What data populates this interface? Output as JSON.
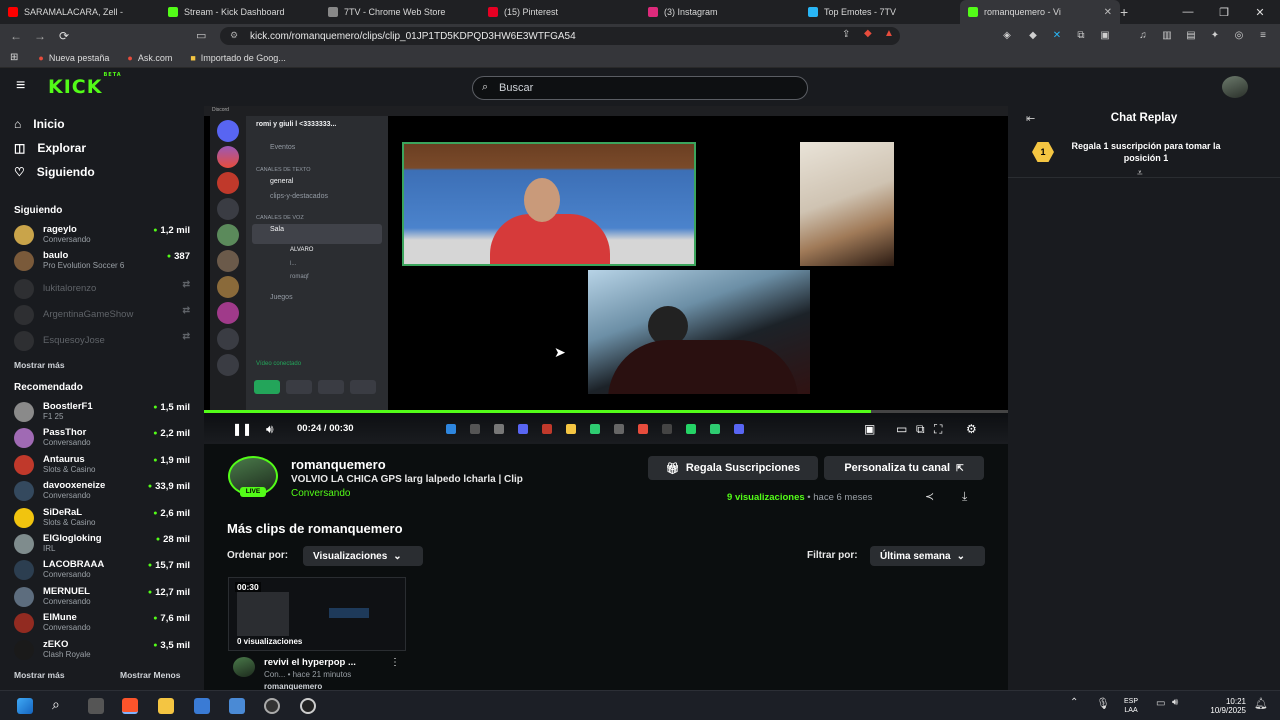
{
  "browser": {
    "tabs": [
      {
        "title": "SARAMALACARA, Zell -",
        "color": "#ff0000"
      },
      {
        "title": "Stream - Kick Dashboard",
        "color": "#53fc18"
      },
      {
        "title": "7TV - Chrome Web Store",
        "color": "#888888"
      },
      {
        "title": "(15) Pinterest",
        "color": "#e60023"
      },
      {
        "title": "(3) Instagram",
        "color": "#dd2a7b"
      },
      {
        "title": "Top Emotes - 7TV",
        "color": "#29b6f6"
      },
      {
        "title": "romanquemero - Vi",
        "color": "#53fc18"
      }
    ],
    "url": "kick.com/romanquemero/clips/clip_01JP1TD5KDPQD3HW6E3WTFGA54",
    "bookmarks": [
      "Nueva pestaña",
      "Ask.com",
      "Importado de Goog..."
    ]
  },
  "header": {
    "logo": "KICK",
    "logo_beta": "BETA",
    "search_placeholder": "Buscar"
  },
  "sidebar": {
    "nav": [
      "Inicio",
      "Explorar",
      "Siguiendo"
    ],
    "following_title": "Siguiendo",
    "following": [
      {
        "name": "rageylo",
        "category": "Conversando",
        "viewers": "1,2 mil",
        "color": "#c9a44a"
      },
      {
        "name": "baulo",
        "category": "Pro Evolution Soccer 6",
        "viewers": "387",
        "color": "#7a5a3a"
      }
    ],
    "offline": [
      "lukitalorenzo",
      "ArgentinaGameShow",
      "EsquesoyJose"
    ],
    "show_more": "Mostrar más",
    "recommended_title": "Recomendado",
    "recommended": [
      {
        "name": "BoostlerF1",
        "category": "F1 25",
        "viewers": "1,5 mil",
        "color": "#8a8a8a"
      },
      {
        "name": "PassThor",
        "category": "Conversando",
        "viewers": "2,2 mil",
        "color": "#a06ab4"
      },
      {
        "name": "Antaurus",
        "category": "Slots & Casino",
        "viewers": "1,9 mil",
        "color": "#c0392b"
      },
      {
        "name": "davooxeneize",
        "category": "Conversando",
        "viewers": "33,9 mil",
        "color": "#34495e"
      },
      {
        "name": "SiDeRaL",
        "category": "Slots & Casino",
        "viewers": "2,6 mil",
        "color": "#f1c40f"
      },
      {
        "name": "ElGlogloking",
        "category": "IRL",
        "viewers": "28 mil",
        "color": "#7f8c8d"
      },
      {
        "name": "LACOBRAAA",
        "category": "Conversando",
        "viewers": "15,7 mil",
        "color": "#2c3e50"
      },
      {
        "name": "MERNUEL",
        "category": "Conversando",
        "viewers": "12,7 mil",
        "color": "#5d6d7e"
      },
      {
        "name": "ElMune",
        "category": "Conversando",
        "viewers": "7,6 mil",
        "color": "#922b21"
      },
      {
        "name": "zEKO",
        "category": "Clash Royale",
        "viewers": "3,5 mil",
        "color": "#1a1a1a"
      }
    ],
    "show_less": "Mostrar Menos"
  },
  "discord": {
    "server": "romi y giuli l <3333333...",
    "events": "Eventos",
    "text_channels": "CANALES DE TEXTO",
    "channels": [
      "general",
      "clips-y-destacados"
    ],
    "voice_channels": "CANALES DE VOZ",
    "voice_room": "Sala",
    "users": [
      "ALVARO",
      "l...",
      "romaqf"
    ],
    "room2": "Juegos",
    "video_connected": "Vídeo conectado"
  },
  "player": {
    "time": "00:24 / 00:30",
    "progress": 0.83
  },
  "clip": {
    "streamer": "romanquemero",
    "title": "VOLVIO LA CHICA GPS larg lalpedo lcharla | Clip",
    "category": "Conversando",
    "live": "LIVE",
    "views_num": "9",
    "views_text": "visualizaciones",
    "ago": "hace 6 meses",
    "gift_button": "Regala Suscripciones",
    "customize_button": "Personaliza tu canal"
  },
  "more_clips": {
    "title": "Más clips de romanquemero",
    "sort_label": "Ordenar por:",
    "sort_value": "Visualizaciones",
    "filter_label": "Filtrar por:",
    "filter_value": "Última semana",
    "card": {
      "duration": "00:30",
      "views": "0 visualizaciones",
      "title": "revivi el hyperpop ...",
      "meta": "Con... • hace 21 minutos",
      "channel": "romanquemero"
    }
  },
  "chat": {
    "title": "Chat Replay",
    "gift_badge": "1",
    "gift_text": "Regala 1 suscripción para tomar la posición 1"
  },
  "taskbar": {
    "lang": "ESP",
    "lang2": "LAA",
    "time": "10:21",
    "date": "10/9/2025"
  }
}
